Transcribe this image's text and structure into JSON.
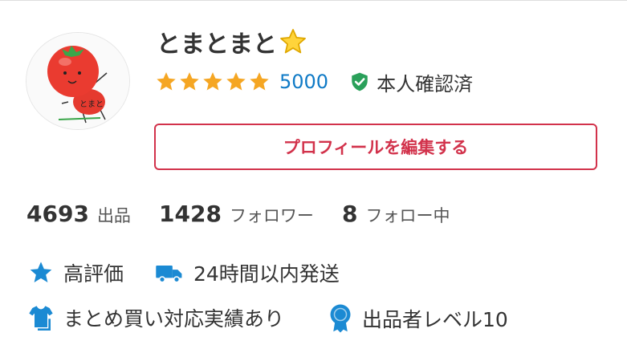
{
  "profile": {
    "avatar_text": "とまと",
    "username": "とまとまと",
    "rating_stars": 5,
    "rating_count": "5000",
    "verified_label": "本人確認済",
    "edit_button": "プロフィールを編集する"
  },
  "stats": [
    {
      "value": "4693",
      "label": "出品"
    },
    {
      "value": "1428",
      "label": "フォロワー"
    },
    {
      "value": "8",
      "label": "フォロー中"
    }
  ],
  "features": [
    {
      "icon": "star-icon",
      "label": "高評価"
    },
    {
      "icon": "truck-icon",
      "label": "24時間以内発送"
    },
    {
      "icon": "shirt-icon",
      "label": "まとめ買い対応実績あり"
    },
    {
      "icon": "badge-icon",
      "label": "出品者レベル10"
    }
  ],
  "colors": {
    "accent": "#d2324b",
    "link": "#0f7ac6",
    "star": "#f5a623",
    "icon_blue": "#1b8ad3",
    "verified": "#2aa05a"
  }
}
